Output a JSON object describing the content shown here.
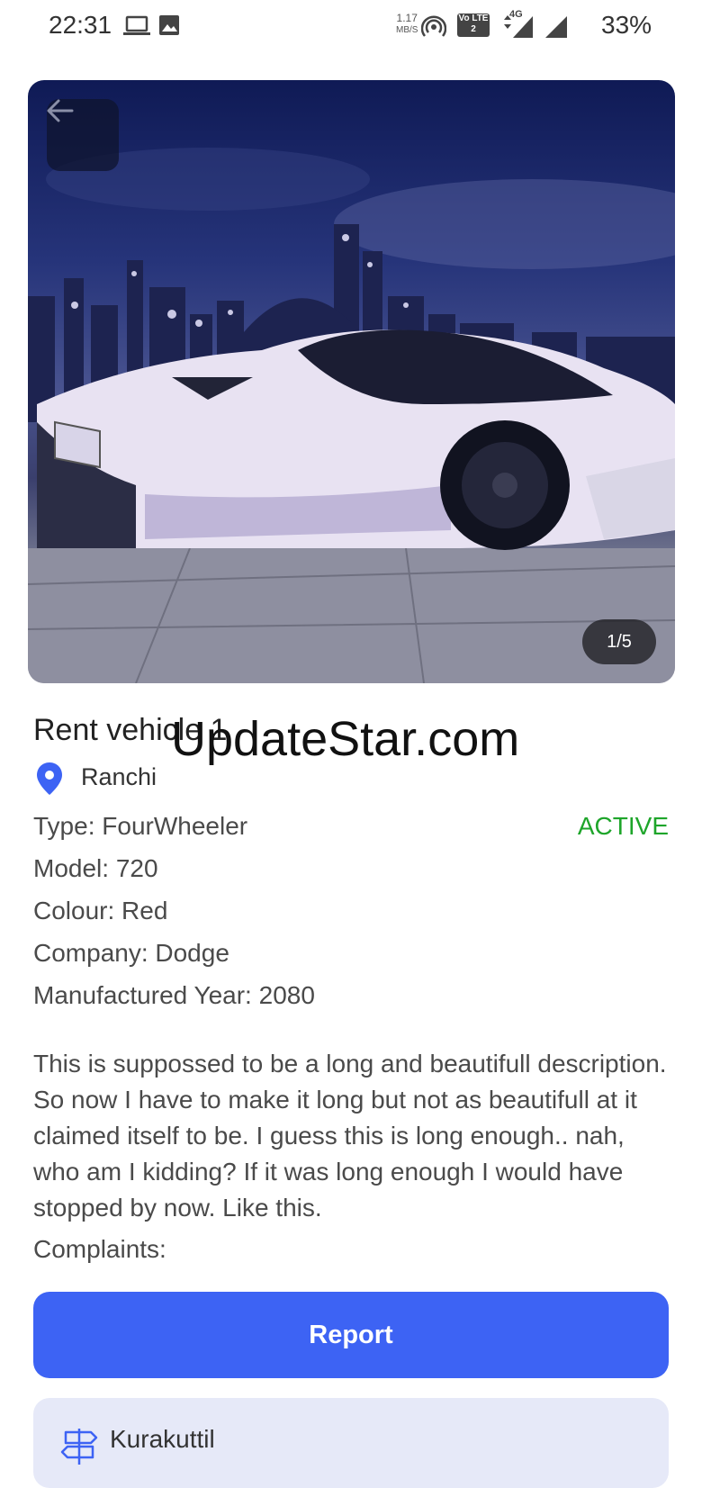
{
  "status_bar": {
    "time": "22:31",
    "speed_value": "1.17",
    "speed_unit": "MB/S",
    "volte_label": "Vo LTE 2",
    "network_label": "4G",
    "battery": "33%"
  },
  "gallery": {
    "counter": "1/5"
  },
  "vehicle": {
    "title": "Rent vehicle 1",
    "location": "Ranchi",
    "status": "ACTIVE",
    "details": [
      "Type: FourWheeler",
      "Model: 720",
      "Colour: Red",
      "Company: Dodge",
      "Manufactured Year: 2080"
    ],
    "description": "This is suppossed to be a long and beautifull description. So now I have to make it long but not as beautifull at it claimed itself to be. I guess this is long enough.. nah, who am I kidding? If it was long enough I would have stopped by now. Like this.",
    "complaints_label": "Complaints:"
  },
  "watermark": "UpdateStar.com",
  "actions": {
    "report_label": "Report"
  },
  "owner": {
    "name": "Kurakuttil"
  },
  "colors": {
    "accent": "#3d63f4",
    "status_active": "#1ea52a",
    "card_bg": "#e6e9f8"
  }
}
